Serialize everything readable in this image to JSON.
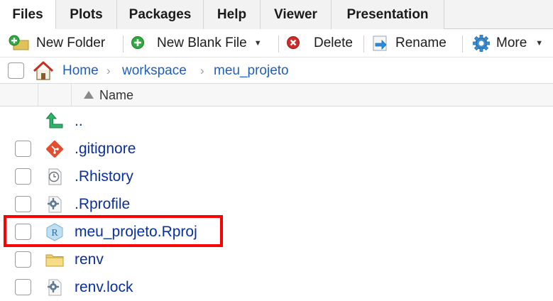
{
  "tabs": [
    {
      "label": "Files",
      "active": true
    },
    {
      "label": "Plots",
      "active": false
    },
    {
      "label": "Packages",
      "active": false
    },
    {
      "label": "Help",
      "active": false
    },
    {
      "label": "Viewer",
      "active": false
    },
    {
      "label": "Presentation",
      "active": false
    }
  ],
  "toolbar": {
    "new_folder": "New Folder",
    "new_blank_file": "New Blank File",
    "delete": "Delete",
    "rename": "Rename",
    "more": "More"
  },
  "breadcrumb": {
    "home": "Home",
    "items": [
      "workspace",
      "meu_projeto"
    ]
  },
  "header": {
    "name": "Name",
    "sort": "ascending"
  },
  "files": [
    {
      "name": "..",
      "icon": "up-arrow-icon",
      "checkbox": false
    },
    {
      "name": ".gitignore",
      "icon": "git-icon",
      "checkbox": true
    },
    {
      "name": ".Rhistory",
      "icon": "history-icon",
      "checkbox": true
    },
    {
      "name": ".Rprofile",
      "icon": "gear-file-icon",
      "checkbox": true
    },
    {
      "name": "meu_projeto.Rproj",
      "icon": "rproj-icon",
      "checkbox": true,
      "highlighted": true
    },
    {
      "name": "renv",
      "icon": "folder-icon",
      "checkbox": true
    },
    {
      "name": "renv.lock",
      "icon": "gear-file-icon",
      "checkbox": true
    }
  ],
  "colors": {
    "link": "#1f5fbf",
    "file_link": "#0a2fa0",
    "highlight": "#ff0000"
  }
}
